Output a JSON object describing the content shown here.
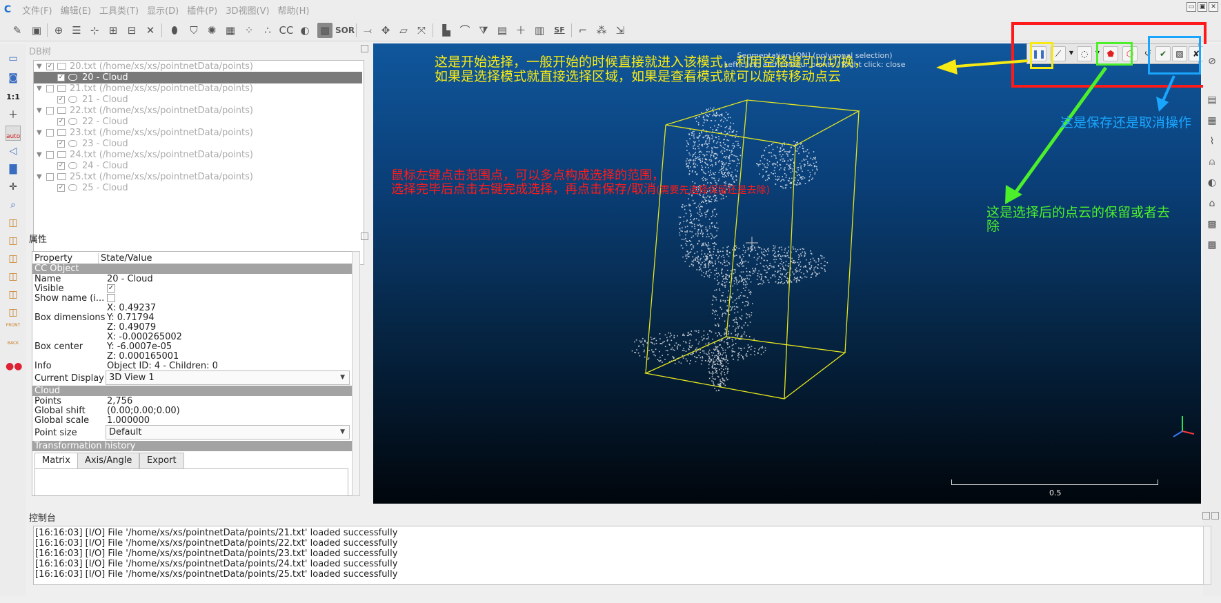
{
  "app": {
    "logo": "C"
  },
  "menu": [
    "文件(F)",
    "编辑(E)",
    "工具类(T)",
    "显示(D)",
    "插件(P)",
    "3D视图(V)",
    "帮助(H)"
  ],
  "toolbar": {
    "sor_label": "SOR",
    "sf_label": "SF"
  },
  "left_toolbar": {
    "one_to_one": "1:1",
    "auto": "auto",
    "front": "FRONT",
    "back": "BACK"
  },
  "db_tree": {
    "title": "DB树",
    "nodes": [
      {
        "label": "20.txt (/home/xs/xs/pointnetData/points)",
        "child": "20 - Cloud",
        "checked": true
      },
      {
        "label": "21.txt (/home/xs/xs/pointnetData/points)",
        "child": "21 - Cloud",
        "checked": false
      },
      {
        "label": "22.txt (/home/xs/xs/pointnetData/points)",
        "child": "22 - Cloud",
        "checked": false
      },
      {
        "label": "23.txt (/home/xs/xs/pointnetData/points)",
        "child": "23 - Cloud",
        "checked": false
      },
      {
        "label": "24.txt (/home/xs/xs/pointnetData/points)",
        "child": "24 - Cloud",
        "checked": false
      },
      {
        "label": "25.txt (/home/xs/xs/pointnetData/points)",
        "child": "25 - Cloud",
        "checked": false
      }
    ]
  },
  "properties": {
    "title": "属性",
    "header": {
      "property": "Property",
      "value": "State/Value"
    },
    "sections": {
      "cc_object": "CC Object",
      "cloud": "Cloud",
      "transform": "Transformation history"
    },
    "name": {
      "k": "Name",
      "v": "20 - Cloud"
    },
    "visible": {
      "k": "Visible",
      "v": "✓"
    },
    "show_name": {
      "k": "Show name (i..."
    },
    "box_dimensions": {
      "k": "Box dimensions",
      "x": "X: 0.49237",
      "y": "Y: 0.71794",
      "z": "Z: 0.49079"
    },
    "box_center": {
      "k": "Box center",
      "x": "X: -0.000265002",
      "y": "Y: -6.0007e-05",
      "z": "Z: 0.000165001"
    },
    "info": {
      "k": "Info",
      "v": "Object ID: 4 - Children: 0"
    },
    "current_display": {
      "k": "Current Display",
      "v": "3D View 1"
    },
    "points": {
      "k": "Points",
      "v": "2,756"
    },
    "global_shift": {
      "k": "Global shift",
      "v": "(0.00;0.00;0.00)"
    },
    "global_scale": {
      "k": "Global scale",
      "v": "1.000000"
    },
    "point_size": {
      "k": "Point size",
      "v": "Default"
    },
    "tabs": [
      "Matrix",
      "Axis/Angle",
      "Export"
    ]
  },
  "viewport": {
    "title_line1": "Segmentation [ON] (polygonal selection)",
    "title_line2": "Left click: add contour points / Right click: close",
    "scale_label": "0.5"
  },
  "annotations": {
    "yellow_line1": "这是开始选择，一般开始的时候直接就进入该模式，利用空格键可以切换，",
    "yellow_line2": "如果是选择模式就直接选择区域，如果是查看模式就可以旋转移动点云",
    "red_line1": "鼠标左键点击范围点，可以多点构成选择的范围，",
    "red_line2": "选择完毕后点击右键完成选择，再点击保存/取消",
    "red_small": "(需要先选择保留还是去除)",
    "blue_text": "这是保存还是取消操作",
    "green_line1": "这是选择后的点云的保留或者去",
    "green_line2": "除"
  },
  "console": {
    "title": "控制台",
    "lines": [
      "[16:16:03] [I/O] File '/home/xs/xs/pointnetData/points/21.txt' loaded successfully",
      "[16:16:03] [I/O] File '/home/xs/xs/pointnetData/points/22.txt' loaded successfully",
      "[16:16:03] [I/O] File '/home/xs/xs/pointnetData/points/23.txt' loaded successfully",
      "[16:16:03] [I/O] File '/home/xs/xs/pointnetData/points/24.txt' loaded successfully",
      "[16:16:03] [I/O] File '/home/xs/xs/pointnetData/points/25.txt' loaded successfully"
    ]
  },
  "colors": {
    "yellow": "#f7ea14",
    "red": "#ff1a1a",
    "blue": "#1aa6ff",
    "green": "#4cf02a",
    "viewport_top": "#10579c"
  }
}
